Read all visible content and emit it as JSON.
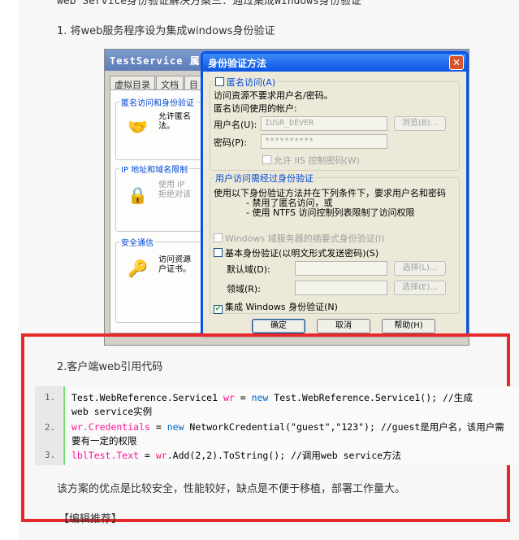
{
  "article": {
    "cut_heading": "web Service身份验证解决方案三：通过集成Windows身份验证",
    "step1": "1. 将web服务程序设为集成windows身份验证",
    "step2": "2.客户端web引用代码",
    "summary": "该方案的优点是比较安全，性能较好，缺点是不便于移植，部署工作量大。",
    "editor_rec": "【编辑推荐】"
  },
  "props_window": {
    "title": "TestService 属性",
    "tabs": [
      "虚拟目录",
      "文档",
      "目"
    ],
    "groups": [
      {
        "title": "匿名访问和身份验证",
        "text": "允许匿名\n法。",
        "icon": "handshake-icon"
      },
      {
        "title": "IP 地址和域名限制",
        "text": "使用 IP\n拒绝对该",
        "icon": "lock-icon"
      },
      {
        "title": "安全通信",
        "text": "访问资源\n户证书。",
        "icon": "key-icon"
      }
    ]
  },
  "auth_dialog": {
    "title": "身份验证方法",
    "anon": {
      "checkbox_label": "匿名访问(A)",
      "desc": "访问资源不要求用户名/密码。",
      "account_label": "匿名访问使用的帐户:",
      "username_label": "用户名(U):",
      "username_value": "IUSR_DEVER",
      "browse_label": "浏览(B)...",
      "password_label": "密码(P):",
      "password_value": "**********",
      "allow_iis_label": "允许 IIS 控制密码(W)"
    },
    "auth": {
      "legend": "用户访问需经过身份验证",
      "desc1": "使用以下身份验证方法并在下列条件下，要求用户名和密码",
      "desc2": "- 禁用了匿名访问，或",
      "desc3": "- 使用 NTFS 访问控制列表限制了访问权限",
      "digest_label": "Windows 域服务器的摘要式身份验证(I)",
      "basic_label": "基本身份验证(以明文形式发送密码)(S)",
      "default_domain_label": "默认域(D):",
      "realm_label": "领域(R):",
      "select_label": "选择(L)...",
      "select2_label": "选择(E)...",
      "integrated_label": "集成 Windows 身份验证(N)"
    },
    "buttons": {
      "ok": "确定",
      "cancel": "取消",
      "help": "帮助(H)"
    }
  },
  "code": {
    "line_numbers": [
      "1.",
      "2.",
      "3."
    ],
    "line1_a": "Test.WebReference.Service1 ",
    "line1_var": "wr",
    "line1_b": " = ",
    "line1_kw": "new",
    "line1_c": " Test.WebReference.Service1(); //生成",
    "line1_wrap": "web service实例",
    "line2_var": "wr.Credentials",
    "line2_b": " = ",
    "line2_kw": "new",
    "line2_c": " NetworkCredential(\"guest\",\"123\"); //guest是用户名，该用户需",
    "line2_wrap": "要有一定的权限",
    "line3_var": "lblTest.Text",
    "line3_b": " = ",
    "line3_var2": "wr",
    "line3_c": ".Add(2,2).ToString(); //调用web service方法"
  },
  "colors": {
    "highlight_border": "#e8292b",
    "code_keyword": "#0066cc",
    "code_var": "#ff1493",
    "gutter_accent": "#6ce26c"
  }
}
